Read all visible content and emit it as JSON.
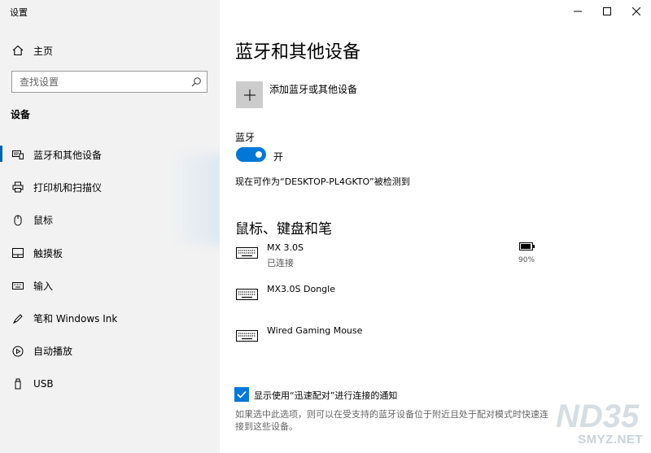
{
  "window": {
    "title": "设置"
  },
  "sidebar": {
    "home_label": "主页",
    "search_placeholder": "查找设置",
    "section": "设备",
    "items": [
      {
        "label": "蓝牙和其他设备",
        "icon": "bluetooth-devices-icon",
        "active": true
      },
      {
        "label": "打印机和扫描仪",
        "icon": "printer-icon"
      },
      {
        "label": "鼠标",
        "icon": "mouse-icon"
      },
      {
        "label": "触摸板",
        "icon": "touchpad-icon"
      },
      {
        "label": "输入",
        "icon": "keyboard-icon"
      },
      {
        "label": "笔和 Windows Ink",
        "icon": "pen-icon"
      },
      {
        "label": "自动播放",
        "icon": "autoplay-icon"
      },
      {
        "label": "USB",
        "icon": "usb-icon"
      }
    ]
  },
  "main": {
    "title": "蓝牙和其他设备",
    "add_label": "添加蓝牙或其他设备",
    "bluetooth_label": "蓝牙",
    "bluetooth_state": "开",
    "discoverable_text": "现在可作为“DESKTOP-PL4GKTO”被检测到",
    "section_title": "鼠标、键盘和笔",
    "devices": [
      {
        "name": "MX 3.0S",
        "status": "已连接",
        "battery": "90%"
      },
      {
        "name": "MX3.0S Dongle",
        "status": ""
      },
      {
        "name": "Wired Gaming Mouse",
        "status": ""
      }
    ],
    "swift_pair_label": "显示使用“迅速配对”进行连接的通知",
    "swift_pair_hint": "如果选中此选项，则可以在受支持的蓝牙设备位于附近且处于配对模式时快速连接到这些设备。"
  },
  "watermark": {
    "logo": "ND35",
    "site": "SMYZ.NET"
  },
  "colors": {
    "accent": "#0078d7",
    "sidebar_bg": "#f2f2f2",
    "active_bar": "#0063b1"
  }
}
